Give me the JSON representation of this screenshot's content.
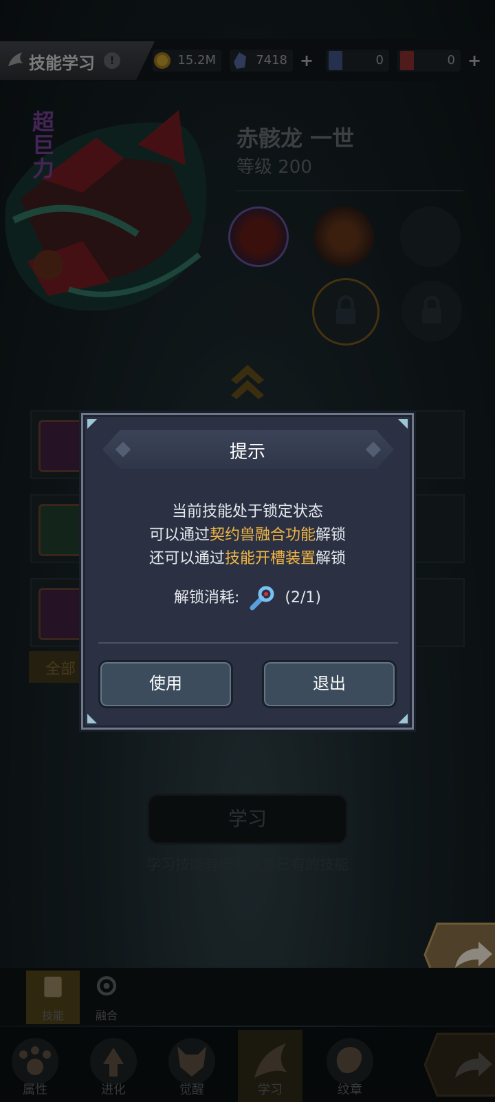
{
  "header": {
    "title": "技能学习",
    "help_icon": "!",
    "resources": [
      {
        "name": "gold",
        "icon": "coin-icon",
        "value": "15.2M",
        "has_plus": false
      },
      {
        "name": "crystal",
        "icon": "crystal-icon",
        "value": "7418",
        "has_plus": true
      },
      {
        "name": "ticket-a",
        "icon": "card-icon",
        "value": "0",
        "has_plus": false
      },
      {
        "name": "ticket-b",
        "icon": "card-icon",
        "value": "0",
        "has_plus": true
      }
    ]
  },
  "pet": {
    "rank_tag": [
      "超",
      "巨",
      "力"
    ],
    "name": "赤骸龙 一世",
    "level": "等级 200"
  },
  "filter": {
    "all_label": "全部"
  },
  "learn": {
    "button_label": "学习",
    "hint": "学习技能有概率覆盖已有的技能"
  },
  "subtabs": [
    {
      "label": "技能",
      "active": true
    },
    {
      "label": "融合",
      "active": false
    }
  ],
  "bottom_nav": [
    {
      "label": "属性"
    },
    {
      "label": "进化"
    },
    {
      "label": "觉醒"
    },
    {
      "label": "学习"
    },
    {
      "label": "纹章"
    }
  ],
  "dialog": {
    "title": "提示",
    "line1": "当前技能处于锁定状态",
    "line2_pre": "可以通过",
    "line2_hl": "契约兽融合功能",
    "line2_post": "解锁",
    "line3_pre": "还可以通过",
    "line3_hl": "技能开槽装置",
    "line3_post": "解锁",
    "cost_label": "解锁消耗:",
    "cost_value": "(2/1)",
    "use_label": "使用",
    "exit_label": "退出"
  },
  "colors": {
    "highlight": "#f2b646",
    "dialog_bg": "#2b3142",
    "button_bg": "#3c4c5c"
  }
}
